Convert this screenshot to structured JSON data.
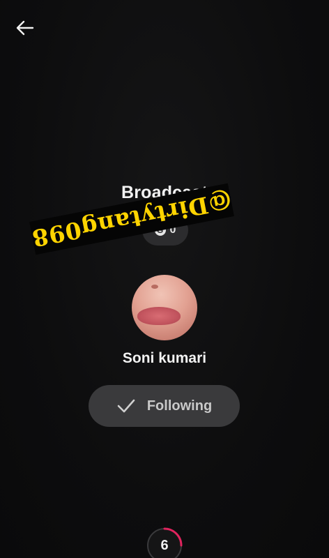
{
  "header": {
    "back_icon": "arrow-left-icon"
  },
  "broadcast": {
    "title": "Broadcast"
  },
  "coins": {
    "icon": "coin-icon",
    "icon_glyph": "G",
    "count": "0"
  },
  "profile": {
    "name": "Soni kumari",
    "follow_label": "Following",
    "follow_icon": "checkmark-icon"
  },
  "timer": {
    "value": "6",
    "progress": 0.25,
    "accent_color": "#e0245e"
  },
  "watermark": {
    "text": "@Dirtytang098"
  },
  "colors": {
    "background": "#0f0f10",
    "pill": "#2c2c2e",
    "button": "#3a3a3c",
    "watermark_text": "#ffd400"
  }
}
